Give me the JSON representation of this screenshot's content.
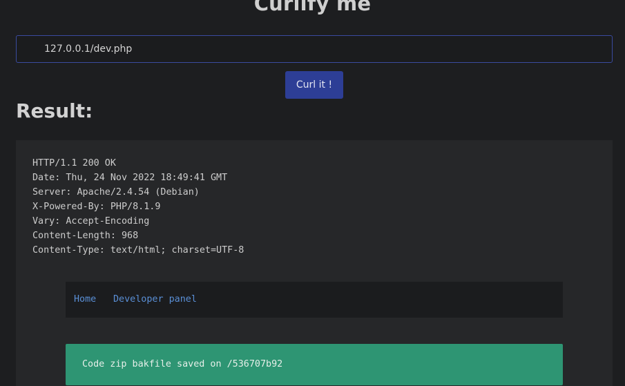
{
  "page": {
    "title": "Curlify me"
  },
  "form": {
    "url_value": "127.0.0.1/dev.php",
    "submit_label": "Curl it !"
  },
  "result": {
    "heading": "Result:",
    "headers": [
      "HTTP/1.1 200 OK",
      "Date: Thu, 24 Nov 2022 18:49:41 GMT",
      "Server: Apache/2.4.54 (Debian)",
      "X-Powered-By: PHP/8.1.9",
      "Vary: Accept-Encoding",
      "Content-Length: 968",
      "Content-Type: text/html; charset=UTF-8"
    ],
    "nav": {
      "home_label": "Home",
      "dev_panel_label": "Developer panel"
    },
    "alert_text": "Code zip bakfile saved on /536707b92"
  },
  "colors": {
    "background": "#1d1e20",
    "button": "#2d3e96",
    "link": "#5a8fd6",
    "alert": "#2e9573"
  }
}
